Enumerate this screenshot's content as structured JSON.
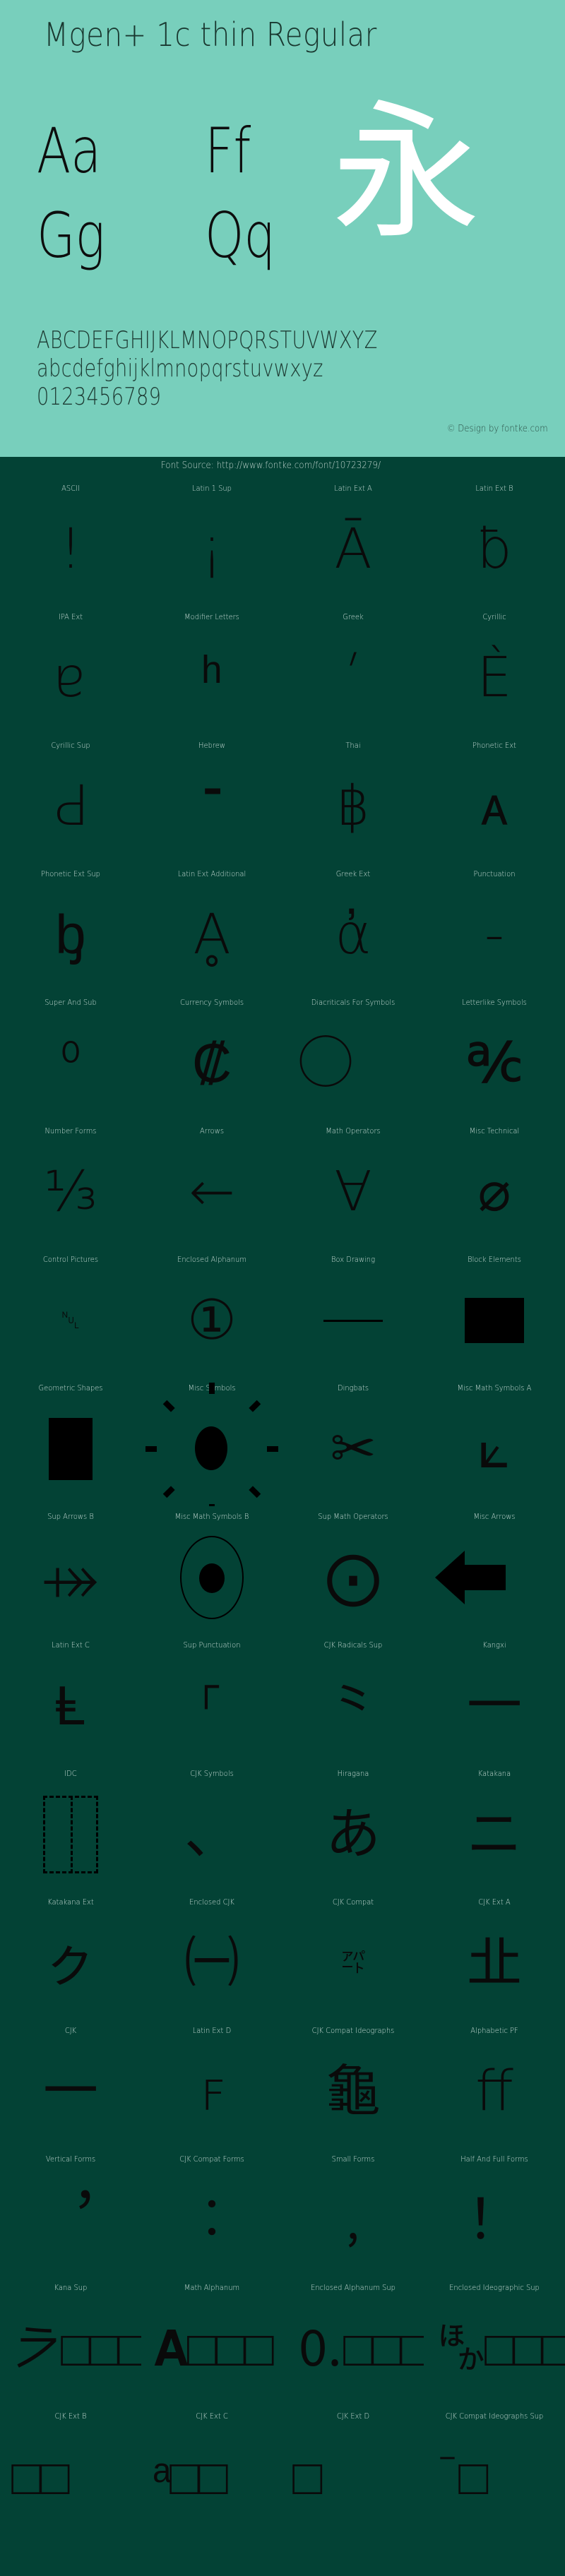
{
  "header": {
    "title": "Mgen+ 1c thin Regular",
    "glyph_pairs": [
      {
        "name": "aa",
        "text": "Aa"
      },
      {
        "name": "ff",
        "text": "Ff"
      },
      {
        "name": "gg",
        "text": "Gg"
      },
      {
        "name": "qq",
        "text": "Qq"
      }
    ],
    "cjk_sample": "永",
    "alphabet_upper": "ABCDEFGHIJKLMNOPQRSTUVWXYZ",
    "alphabet_lower": "abcdefghijklmnopqrstuvwxyz",
    "digits": "0123456789",
    "copyright": "© Design by fontke.com",
    "bg_color": "#78cfbc",
    "text_color": "#19372f",
    "cjk_color": "#ffffff"
  },
  "font_source": {
    "label": "Font Source: http://www.fontke.com/font/10723279/"
  },
  "body_style": {
    "bg_color": "#034235",
    "label_color": "#c8dcd6",
    "glyph_color": "#0a0a0a"
  },
  "blocks": [
    {
      "label": "ASCII",
      "sample": "!",
      "style": "thin"
    },
    {
      "label": "Latin 1 Sup",
      "sample": "¡",
      "style": "thin"
    },
    {
      "label": "Latin Ext A",
      "sample": "Ā",
      "style": "thin"
    },
    {
      "label": "Latin Ext B",
      "sample": "ƀ",
      "style": "thin"
    },
    {
      "label": "IPA Ext",
      "sample": "ɐ",
      "style": "thin"
    },
    {
      "label": "Modifier Letters",
      "sample": "ʰ",
      "style": "thin"
    },
    {
      "label": "Greek",
      "sample": "ʹ",
      "style": "thin"
    },
    {
      "label": "Cyrillic",
      "sample": "Ѐ",
      "style": "thin"
    },
    {
      "label": "Cyrillic Sup",
      "sample": "Ԁ",
      "style": "thin"
    },
    {
      "label": "Hebrew",
      "sample": "־",
      "style": "thin"
    },
    {
      "label": "Thai",
      "sample": "฿",
      "style": "thin"
    },
    {
      "label": "Phonetic Ext",
      "sample": "ᴀ",
      "style": "thin"
    },
    {
      "label": "Phonetic Ext Sup",
      "sample": "ᶀ",
      "style": "thin"
    },
    {
      "label": "Latin Ext Additional",
      "sample": "Ḁ",
      "style": "thin"
    },
    {
      "label": "Greek Ext",
      "sample": "ἀ",
      "style": "thin"
    },
    {
      "label": "Punctuation",
      "sample": "‐",
      "style": "thin"
    },
    {
      "label": "Super And Sub",
      "sample": "⁰",
      "style": "thin"
    },
    {
      "label": "Currency Symbols",
      "sample": "₡",
      "style": "thin"
    },
    {
      "label": "Diacriticals For Symbols",
      "sample": "⃝",
      "style": "thin"
    },
    {
      "label": "Letterlike Symbols",
      "sample": "℀",
      "style": "thin"
    },
    {
      "label": "Number Forms",
      "sample": "⅓",
      "style": "thin"
    },
    {
      "label": "Arrows",
      "sample": "←",
      "style": "thin"
    },
    {
      "label": "Math Operators",
      "sample": "∀",
      "style": "thin"
    },
    {
      "label": "Misc Technical",
      "sample": "⌀",
      "style": "thin"
    },
    {
      "label": "Control Pictures",
      "sample": "␀",
      "style": "small"
    },
    {
      "label": "Enclosed Alphanum",
      "sample": "①",
      "style": "thin"
    },
    {
      "label": "Box Drawing",
      "sample": "─",
      "style": "shape-hline"
    },
    {
      "label": "Block Elements",
      "sample": "▀",
      "style": "shape-rect-wide"
    },
    {
      "label": "Geometric Shapes",
      "sample": "■",
      "style": "shape-rect-tall"
    },
    {
      "label": "Misc Symbols",
      "sample": "☀",
      "style": "shape-sun"
    },
    {
      "label": "Dingbats",
      "sample": "✂",
      "style": "heavy"
    },
    {
      "label": "Misc Math Symbols A",
      "sample": "⟀",
      "style": "thin"
    },
    {
      "label": "Sup Arrows B",
      "sample": "⤀",
      "style": "thin"
    },
    {
      "label": "Misc Math Symbols B",
      "sample": "⦀",
      "style": "shape-circle-dot"
    },
    {
      "label": "Sup Math Operators",
      "sample": "⨀",
      "style": "thin"
    },
    {
      "label": "Misc Arrows",
      "sample": "⬀",
      "style": "shape-arrow-left"
    },
    {
      "label": "Latin Ext C",
      "sample": "Ⱡ",
      "style": "thin"
    },
    {
      "label": "Sup Punctuation",
      "sample": "⸀",
      "style": "thin"
    },
    {
      "label": "CJK Radicals Sup",
      "sample": "⺀",
      "style": "thin"
    },
    {
      "label": "Kangxi",
      "sample": "⼀",
      "style": "thin"
    },
    {
      "label": "IDC",
      "sample": "⿰",
      "style": "shape-dashbox"
    },
    {
      "label": "CJK Symbols",
      "sample": "、",
      "style": "thin"
    },
    {
      "label": "Hiragana",
      "sample": "あ",
      "style": "thin"
    },
    {
      "label": "Katakana",
      "sample": "ニ",
      "style": "thin"
    },
    {
      "label": "Katakana Ext",
      "sample": "ㇰ",
      "style": "thin"
    },
    {
      "label": "Enclosed CJK",
      "sample": "㈠",
      "style": "thin"
    },
    {
      "label": "CJK Compat",
      "sample": "㌀",
      "style": "small"
    },
    {
      "label": "CJK Ext A",
      "sample": "㐀",
      "style": "thin"
    },
    {
      "label": "CJK",
      "sample": "一",
      "style": "thin"
    },
    {
      "label": "Latin Ext D",
      "sample": "ꜰ",
      "style": "thin"
    },
    {
      "label": "CJK Compat Ideographs",
      "sample": "龜",
      "style": "thin"
    },
    {
      "label": "Alphabetic PF",
      "sample": "ﬀ",
      "style": "thin"
    },
    {
      "label": "Vertical Forms",
      "sample": "︐",
      "style": "thin"
    },
    {
      "label": "CJK Compat Forms",
      "sample": "︰",
      "style": "thin"
    },
    {
      "label": "Small Forms",
      "sample": "﹐",
      "style": "thin"
    },
    {
      "label": "Half And Full Forms",
      "sample": "！",
      "style": "thin"
    },
    {
      "label": "Kana Sup",
      "sample": "𛀀□□□",
      "style": "overflow"
    },
    {
      "label": "Math Alphanum",
      "sample": "𝐀□□□",
      "style": "overflow"
    },
    {
      "label": "Enclosed Alphanum Sup",
      "sample": "🄀□□□",
      "style": "overflow"
    },
    {
      "label": "Enclosed Ideographic Sup",
      "sample": "🈀□□□",
      "style": "overflow"
    },
    {
      "label": "CJK Ext B",
      "sample": "𠀀□□",
      "style": "overflow"
    },
    {
      "label": "CJK Ext C",
      "sample": "𪛖ᵃ□□",
      "style": "overflow"
    },
    {
      "label": "CJK Ext D",
      "sample": "𫠝≪□",
      "style": "overflow"
    },
    {
      "label": "CJK Compat Ideographs Sup",
      "sample": "丽¯□",
      "style": "overflow"
    }
  ]
}
